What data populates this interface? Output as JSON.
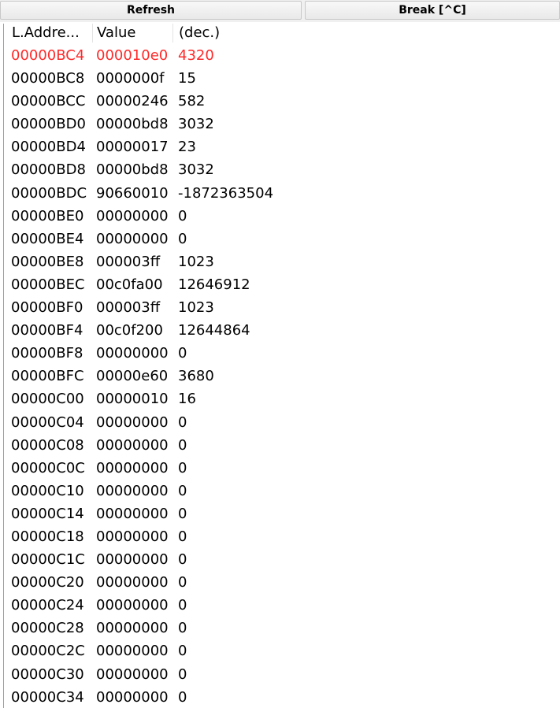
{
  "toolbar": {
    "refresh_label": "Refresh",
    "break_label": "Break [^C]"
  },
  "columns": {
    "address": "L.Addre...",
    "value": "Value",
    "decimal": "(dec.)"
  },
  "colors": {
    "highlight_row": "#ff2a2a"
  },
  "rows": [
    {
      "address": "00000BC4",
      "value": "000010e0",
      "decimal": "4320",
      "highlighted": true
    },
    {
      "address": "00000BC8",
      "value": "0000000f",
      "decimal": "15"
    },
    {
      "address": "00000BCC",
      "value": "00000246",
      "decimal": "582"
    },
    {
      "address": "00000BD0",
      "value": "00000bd8",
      "decimal": "3032"
    },
    {
      "address": "00000BD4",
      "value": "00000017",
      "decimal": "23"
    },
    {
      "address": "00000BD8",
      "value": "00000bd8",
      "decimal": "3032"
    },
    {
      "address": "00000BDC",
      "value": "90660010",
      "decimal": "-1872363504"
    },
    {
      "address": "00000BE0",
      "value": "00000000",
      "decimal": "0"
    },
    {
      "address": "00000BE4",
      "value": "00000000",
      "decimal": "0"
    },
    {
      "address": "00000BE8",
      "value": "000003ff",
      "decimal": "1023"
    },
    {
      "address": "00000BEC",
      "value": "00c0fa00",
      "decimal": "12646912"
    },
    {
      "address": "00000BF0",
      "value": "000003ff",
      "decimal": "1023"
    },
    {
      "address": "00000BF4",
      "value": "00c0f200",
      "decimal": "12644864"
    },
    {
      "address": "00000BF8",
      "value": "00000000",
      "decimal": "0"
    },
    {
      "address": "00000BFC",
      "value": "00000e60",
      "decimal": "3680"
    },
    {
      "address": "00000C00",
      "value": "00000010",
      "decimal": "16"
    },
    {
      "address": "00000C04",
      "value": "00000000",
      "decimal": "0"
    },
    {
      "address": "00000C08",
      "value": "00000000",
      "decimal": "0"
    },
    {
      "address": "00000C0C",
      "value": "00000000",
      "decimal": "0"
    },
    {
      "address": "00000C10",
      "value": "00000000",
      "decimal": "0"
    },
    {
      "address": "00000C14",
      "value": "00000000",
      "decimal": "0"
    },
    {
      "address": "00000C18",
      "value": "00000000",
      "decimal": "0"
    },
    {
      "address": "00000C1C",
      "value": "00000000",
      "decimal": "0"
    },
    {
      "address": "00000C20",
      "value": "00000000",
      "decimal": "0"
    },
    {
      "address": "00000C24",
      "value": "00000000",
      "decimal": "0"
    },
    {
      "address": "00000C28",
      "value": "00000000",
      "decimal": "0"
    },
    {
      "address": "00000C2C",
      "value": "00000000",
      "decimal": "0"
    },
    {
      "address": "00000C30",
      "value": "00000000",
      "decimal": "0"
    },
    {
      "address": "00000C34",
      "value": "00000000",
      "decimal": "0"
    }
  ]
}
